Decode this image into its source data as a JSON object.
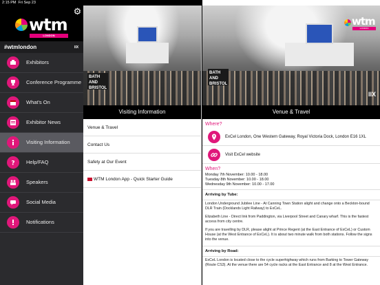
{
  "status_bar": {
    "time": "2:15 PM",
    "date": "Fri Sep 23",
    "battery": "100%"
  },
  "brand": {
    "logo_text": "wtm",
    "logo_city": "LONDON",
    "hashtag": "#wtmlondon"
  },
  "sidebar": {
    "items": [
      {
        "label": "Exhibitors",
        "icon": "exhibitors-icon"
      },
      {
        "label": "Conference Programme",
        "icon": "trophy-icon"
      },
      {
        "label": "What's On",
        "icon": "calendar-icon"
      },
      {
        "label": "Exhibitor News",
        "icon": "news-icon"
      },
      {
        "label": "Visiting Information",
        "icon": "info-icon"
      },
      {
        "label": "Help/FAQ",
        "icon": "help-icon"
      },
      {
        "label": "Speakers",
        "icon": "speakers-icon"
      },
      {
        "label": "Social Media",
        "icon": "social-icon"
      },
      {
        "label": "Notifications",
        "icon": "notifications-icon"
      }
    ]
  },
  "middle": {
    "title": "Visiting Information",
    "hero_sign": "BATH AND BRISTOL",
    "items": [
      {
        "label": "Venue & Travel"
      },
      {
        "label": "Contact Us"
      },
      {
        "label": "Safety at Our Event"
      },
      {
        "label": "WTM London App - Quick Starter Guide"
      }
    ]
  },
  "detail": {
    "title": "Venue & Travel",
    "hero_badge": "IIX",
    "where": {
      "heading": "Where?",
      "address": "ExCel London, One Western Gateway, Royal Victoria Dock, London E16 1XL",
      "website": "Visit ExCel website"
    },
    "when": {
      "heading": "When?",
      "lines": [
        "Monday 7th November: 10.00 - 18.00",
        "Tuesday 8th November: 10.00 - 18.00",
        "Wednesday 9th November: 10.00 - 17.00"
      ]
    },
    "by_tube": {
      "heading": "Arriving by Tube:",
      "p1": "London Underground Jubilee Line - At Canning Town Station alight and change onto a Beckton-bound DLR Train (Docklands Light Railway) to ExCeL.",
      "p2": "Elizabeth Line - Direct link from Paddington, via Liverpool Street and Canary wharf. This is the fastest access from city centre.",
      "p3": "If you are travelling by DLR, please alight at Prince Regent (at the East Entrance of ExCeL) or Custom House (at the West Entrance of ExCeL). It is about two minute walk from both stations. Follow the signs into the venue."
    },
    "by_road": {
      "heading": "Arriving by Road:",
      "p1": "ExCeL London is located close to the cycle superhighway which runs from Barking to Tower Gateway (Route CS3). At the venue there are 54 cycle racks at the East Entrance and 8 at the West Entrance."
    }
  },
  "colors": {
    "accent": "#e0177a",
    "sidebar_bg": "#2b2b2e",
    "header_bg": "#000000"
  }
}
